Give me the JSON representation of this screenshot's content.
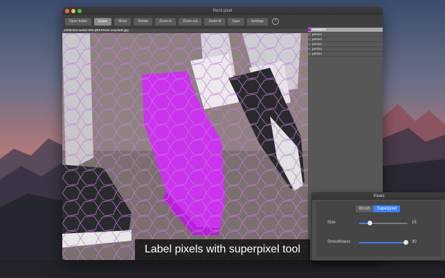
{
  "window": {
    "title": "Recti pixel"
  },
  "toolbar": {
    "buttons": [
      {
        "label": "Open folder",
        "active": false
      },
      {
        "label": "Erase",
        "active": true
      },
      {
        "label": "Move",
        "active": false
      },
      {
        "label": "Rotate",
        "active": false
      },
      {
        "label": "Zoom in",
        "active": false
      },
      {
        "label": "Zoom out",
        "active": false
      },
      {
        "label": "Zoom fit",
        "active": false
      },
      {
        "label": "Save",
        "active": false
      },
      {
        "label": "Settings",
        "active": false
      }
    ],
    "help": "?"
  },
  "image": {
    "filename": "10/58 ben-weber-BW-pBSSNUE-unsplash.jpg"
  },
  "labels": {
    "items": [
      {
        "name": "sneakers",
        "selected": true,
        "color": "#d400d4"
      },
      {
        "name": "person",
        "selected": false,
        "color": "#6a6a6a"
      },
      {
        "name": "person",
        "selected": false,
        "color": "#6a6a6a"
      },
      {
        "name": "person",
        "selected": false,
        "color": "#6a6a6a"
      },
      {
        "name": "person",
        "selected": false,
        "color": "#6a6a6a"
      },
      {
        "name": "person",
        "selected": false,
        "color": "#6a6a6a"
      }
    ]
  },
  "caption": "Label pixels with superpixel tool",
  "pixels_panel": {
    "title": "Pixels",
    "modes": [
      "Brush",
      "Superpixel"
    ],
    "active_mode": "Superpixel",
    "size": {
      "label": "Size",
      "value": "15",
      "fraction": 0.22
    },
    "smoothness": {
      "label": "Smoothness",
      "value": "30",
      "fraction": 0.96
    }
  },
  "colors": {
    "accent": "#3a82f7",
    "mask": "#cc33ee"
  }
}
